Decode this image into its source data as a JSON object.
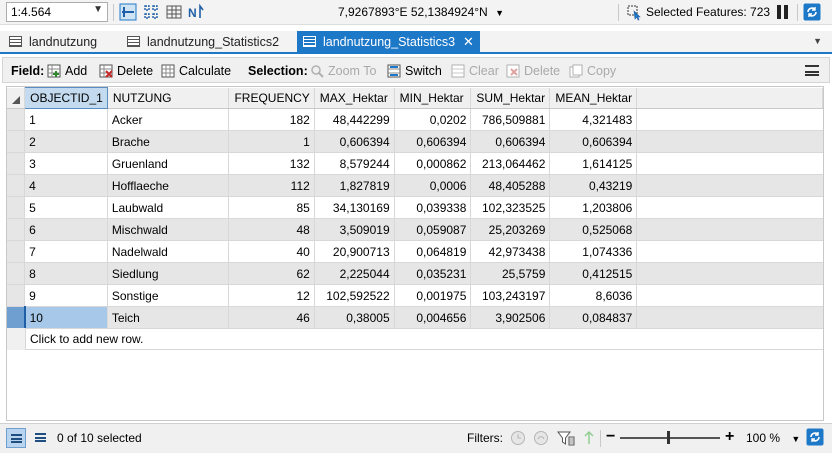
{
  "statusbar": {
    "scale": "1:4.564",
    "coordinates": "7,9267893°E 52,1384924°N",
    "selected_features": "Selected Features: 723"
  },
  "tabs": [
    {
      "label": "landnutzung",
      "active": false
    },
    {
      "label": "landnutzung_Statistics2",
      "active": false
    },
    {
      "label": "landnutzung_Statistics3",
      "active": true
    }
  ],
  "toolbar": {
    "field_label": "Field:",
    "add": "Add",
    "delete": "Delete",
    "calculate": "Calculate",
    "selection_label": "Selection:",
    "zoom_to": "Zoom To",
    "switch": "Switch",
    "clear": "Clear",
    "delete_sel": "Delete",
    "copy": "Copy"
  },
  "table": {
    "columns": [
      "OBJECTID_1",
      "NUTZUNG",
      "FREQUENCY",
      "MAX_Hektar",
      "MIN_Hektar",
      "SUM_Hektar",
      "MEAN_Hektar"
    ],
    "rows": [
      [
        "1",
        "Acker",
        "182",
        "48,442299",
        "0,0202",
        "786,509881",
        "4,321483"
      ],
      [
        "2",
        "Brache",
        "1",
        "0,606394",
        "0,606394",
        "0,606394",
        "0,606394"
      ],
      [
        "3",
        "Gruenland",
        "132",
        "8,579244",
        "0,000862",
        "213,064462",
        "1,614125"
      ],
      [
        "4",
        "Hofflaeche",
        "112",
        "1,827819",
        "0,0006",
        "48,405288",
        "0,43219"
      ],
      [
        "5",
        "Laubwald",
        "85",
        "34,130169",
        "0,039338",
        "102,323525",
        "1,203806"
      ],
      [
        "6",
        "Mischwald",
        "48",
        "3,509019",
        "0,059087",
        "25,203269",
        "0,525068"
      ],
      [
        "7",
        "Nadelwald",
        "40",
        "20,900713",
        "0,064819",
        "42,973438",
        "1,074336"
      ],
      [
        "8",
        "Siedlung",
        "62",
        "2,225044",
        "0,035231",
        "25,5759",
        "0,412515"
      ],
      [
        "9",
        "Sonstige",
        "12",
        "102,592522",
        "0,001975",
        "103,243197",
        "8,6036"
      ],
      [
        "10",
        "Teich",
        "46",
        "0,38005",
        "0,004656",
        "3,902506",
        "0,084837"
      ]
    ],
    "add_row_text": "Click to add new row.",
    "selected_row": 10
  },
  "bottombar": {
    "selection_count": "0 of 10 selected",
    "filters_label": "Filters:",
    "zoom": "100 %"
  },
  "colors": {
    "accent": "#1e78c8",
    "header_selected": "#c4dbef",
    "row_alt": "#e6e6e6"
  }
}
